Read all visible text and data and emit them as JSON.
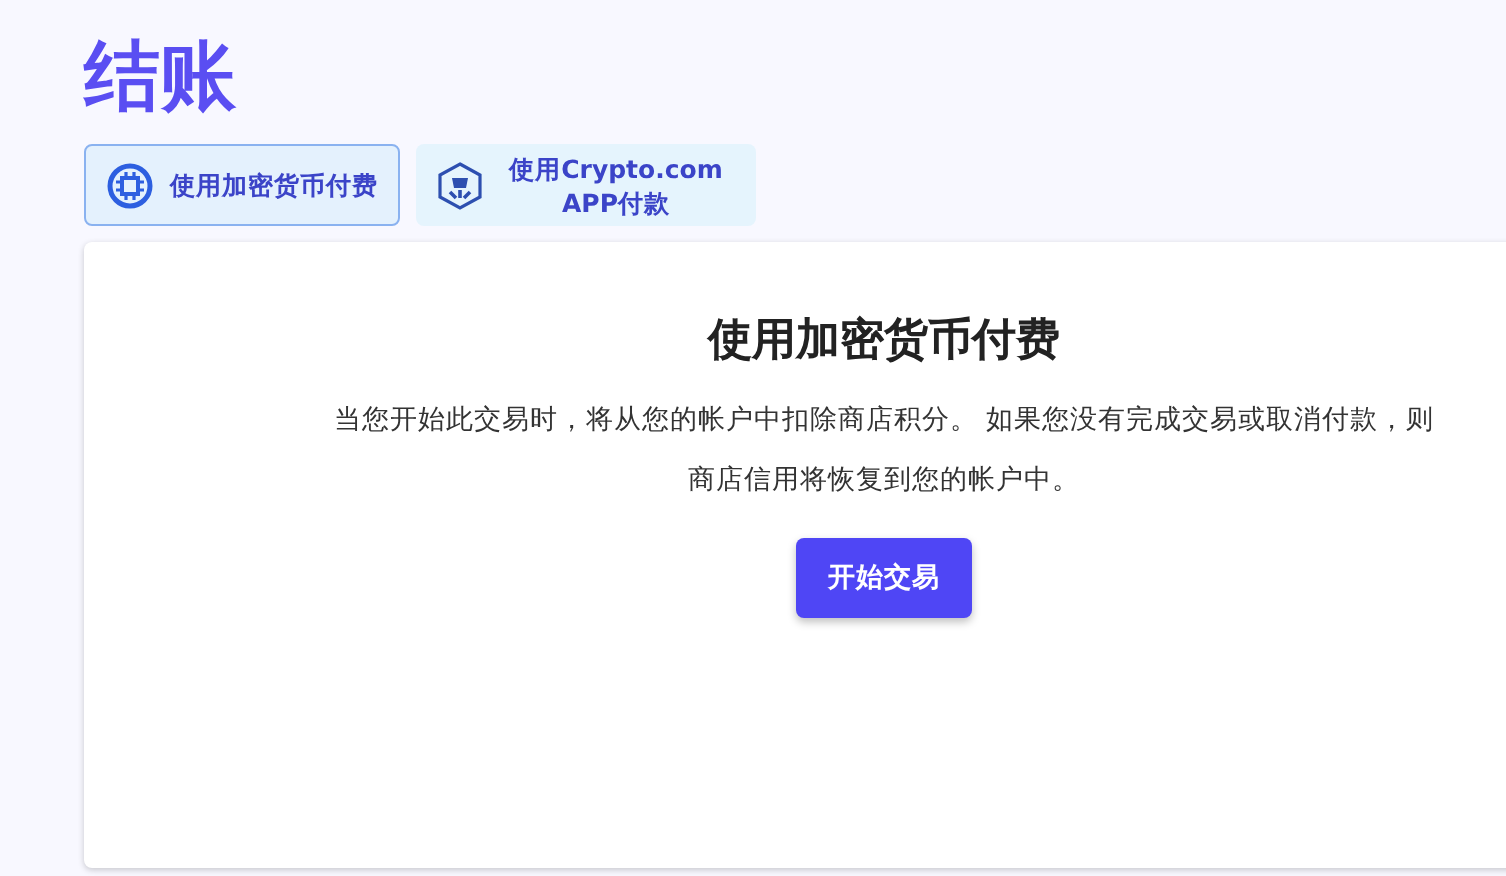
{
  "title": "结账",
  "tabs": [
    {
      "label": "使用加密货币付费",
      "kind": "coin",
      "selected": true
    },
    {
      "label": "使用Crypto.com APP付款",
      "kind": "hexagon",
      "selected": false
    }
  ],
  "panel": {
    "heading": "使用加密货币付费",
    "text": "当您开始此交易时，将从您的帐户中扣除商店积分。 如果您没有完成交易或取消付款，则商店信用将恢复到您的帐户中。",
    "button": "开始交易"
  }
}
